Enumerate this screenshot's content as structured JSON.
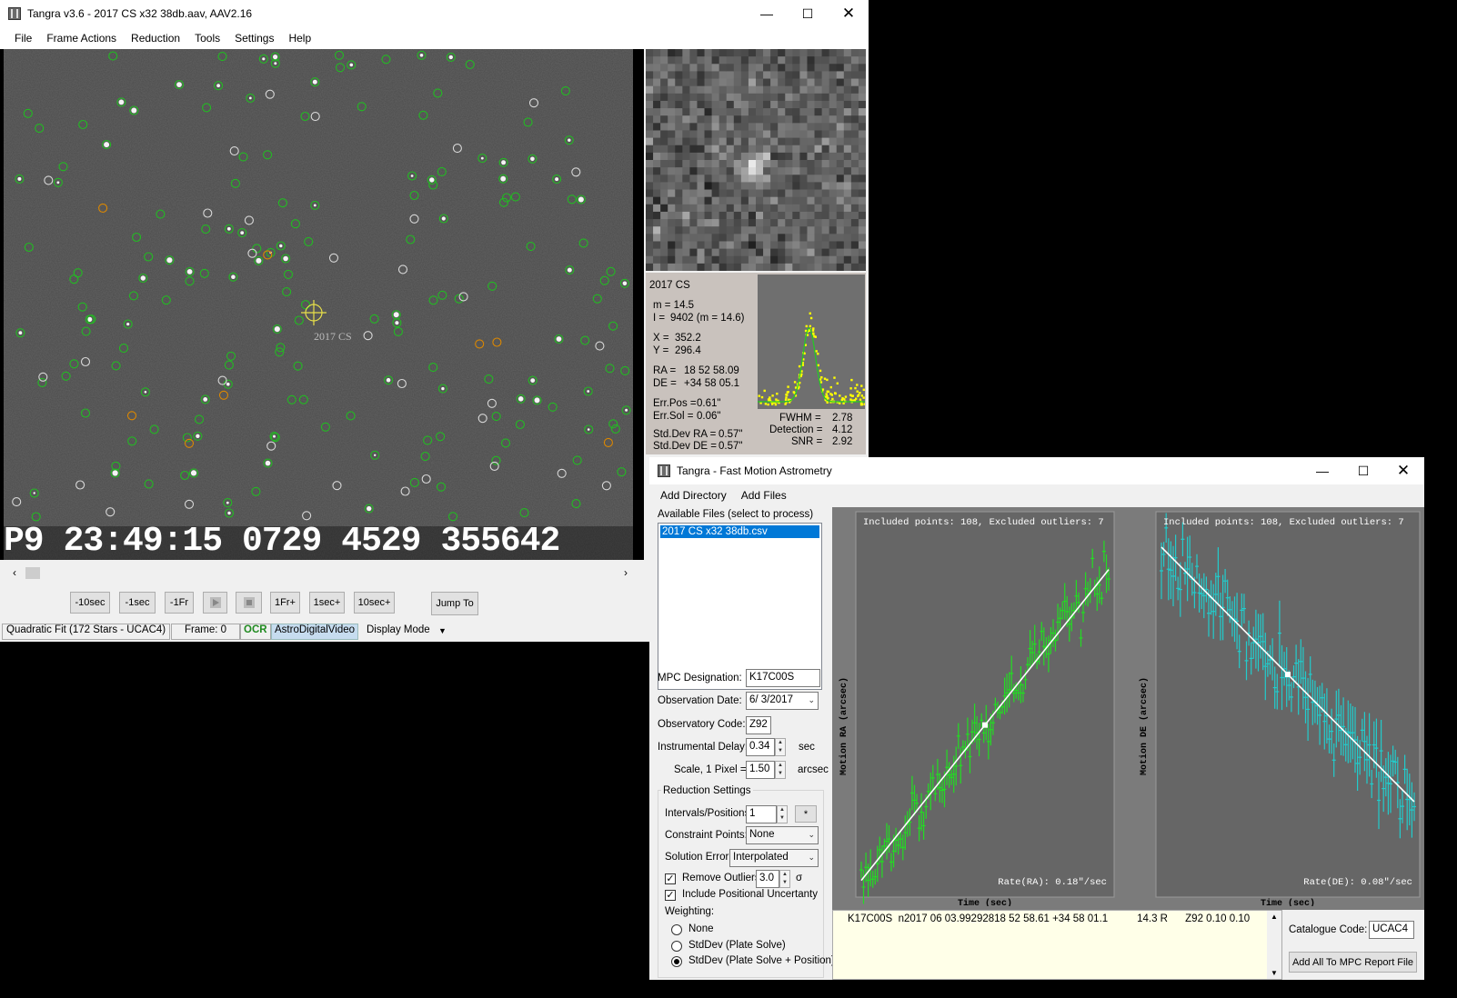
{
  "main": {
    "title": "Tangra v3.6 - 2017 CS x32 38db.aav, AAV2.16",
    "menu": [
      "File",
      "Frame Actions",
      "Reduction",
      "Tools",
      "Settings",
      "Help"
    ],
    "overlay_label": "2017 CS",
    "timestamp_parts": [
      "P9",
      "23:49:15",
      "0729",
      "4529",
      "355642"
    ],
    "buttons": [
      "-10sec",
      "-1sec",
      "-1Fr",
      "1Fr+",
      "1sec+",
      "10sec+"
    ],
    "jump_to": "Jump To",
    "status": {
      "fit": "Quadratic Fit (172 Stars - UCAC4)",
      "frame": "Frame: 0",
      "ocr": "OCR",
      "video": "AstroDigitalVideo",
      "display_mode": "Display Mode"
    },
    "object": {
      "name": "2017 CS",
      "lines": [
        {
          "k": "m = 14.5",
          "v": ""
        },
        {
          "k": "I =",
          "v": "9402 (m = 14.6)"
        },
        {
          "k": "X =",
          "v": "352.2"
        },
        {
          "k": "Y =",
          "v": "296.4"
        },
        {
          "k": "RA =",
          "v": "18 52 58.09"
        },
        {
          "k": "DE =",
          "v": "+34 58 05.1"
        },
        {
          "k": "Err.Pos =",
          "v": "0.61\""
        },
        {
          "k": "Err.Sol =",
          "v": "0.06\""
        },
        {
          "k": "Std.Dev RA =",
          "v": "0.57\""
        },
        {
          "k": "Std.Dev DE =",
          "v": "0.57\""
        }
      ],
      "fwhm_label": "FWHM =",
      "fwhm": "2.78",
      "detection_label": "Detection =",
      "detection": "4.12",
      "snr_label": "SNR =",
      "snr": "2.92"
    }
  },
  "fma": {
    "title": "Tangra - Fast Motion Astrometry",
    "menu": [
      "Add Directory",
      "Add Files"
    ],
    "available_label": "Available Files (select to process)",
    "files": [
      "2017 CS x32 38db.csv"
    ],
    "mpc_designation_label": "MPC Designation:",
    "mpc_designation": "K17C00S",
    "obs_date_label": "Observation Date:",
    "obs_date": "6/ 3/2017",
    "observatory_label": "Observatory Code:",
    "observatory": "Z92",
    "inst_delay_label": "Instrumental Delay:",
    "inst_delay": "0.34",
    "inst_delay_unit": "sec",
    "scale_label": "Scale, 1 Pixel =",
    "scale": "1.50",
    "scale_unit": "arcsec",
    "reduction_settings": "Reduction Settings",
    "intervals_label": "Intervals/Positions:",
    "intervals": "1",
    "intervals_btn": "*",
    "constraint_label": "Constraint Points:",
    "constraint": "None",
    "solution_error_label": "Solution Error:",
    "solution_error": "Interpolated",
    "remove_outliers": "Remove Outliers",
    "outlier_sigma": "3.0",
    "sigma_symbol": "σ",
    "include_uncertainty": "Include Positional Uncertanty",
    "weighting_label": "Weighting:",
    "weighting": [
      "None",
      "StdDev (Plate Solve)",
      "StdDev (Plate Solve + Position)"
    ],
    "weighting_selected": 2,
    "result_line": "K17C00S  n2017 06 03.99292818 52 58.61 +34 58 01.1          14.3 R      Z92 0.10 0.10",
    "catalogue_label": "Catalogue Code:",
    "catalogue": "UCAC4",
    "add_report": "Add All To MPC Report File"
  },
  "chart_data": [
    {
      "type": "scatter",
      "title": "Included points: 108, Excluded outliers: 7",
      "xlabel": "Time (sec)",
      "ylabel": "Motion RA (arcsec)",
      "rate_text": "Rate(RA): 0.18\"/sec",
      "color": "#22dd22",
      "trend": "increasing",
      "fit_start": [
        0.0,
        0.03
      ],
      "fit_end": [
        1.0,
        0.86
      ],
      "scatter_spread": 0.03,
      "error_bar": 0.035,
      "n_points": 108,
      "grid": false
    },
    {
      "type": "scatter",
      "title": "Included points: 108, Excluded outliers: 7",
      "xlabel": "Time (sec)",
      "ylabel": "Motion DE (arcsec)",
      "rate_text": "Rate(DE): 0.08\"/sec",
      "color": "#22cccc",
      "trend": "decreasing",
      "fit_start": [
        0.0,
        0.92
      ],
      "fit_end": [
        1.0,
        0.24
      ],
      "scatter_spread": 0.04,
      "error_bar": 0.06,
      "n_points": 108,
      "grid": false
    }
  ],
  "colors": {
    "star_marker": "#22bb22",
    "excluded_marker": "#d9d9d9",
    "orange_marker": "#dd8800",
    "target_cross": "#e8e04a",
    "selection": "#0078d7",
    "profile_points": "#ffff00"
  }
}
